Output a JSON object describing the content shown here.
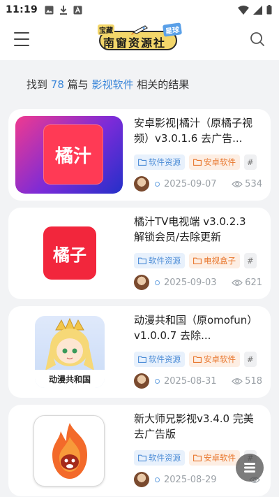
{
  "status_bar": {
    "time": "11:19"
  },
  "header": {
    "logo_main": "南窗资源社",
    "logo_tag_left": "宝藏",
    "logo_tag_right": "星球"
  },
  "search_result": {
    "prefix": "找到",
    "count": "78",
    "middle": "篇与",
    "keyword": "影视软件",
    "suffix": "相关的结果"
  },
  "posts": [
    {
      "title": "安卓影视|橘汁（原橘子视频）v3.0.1.6 去广告...",
      "thumb_text": "橘汁",
      "tags": [
        {
          "label": "软件资源",
          "style": "blue"
        },
        {
          "label": "安卓软件",
          "style": "orange"
        },
        {
          "label": "#",
          "style": "hash"
        }
      ],
      "date": "2025-09-07",
      "views": "534"
    },
    {
      "title": "橘汁TV电视端 v3.0.2.3 解锁会员/去除更新",
      "thumb_text": "橘子",
      "tags": [
        {
          "label": "软件资源",
          "style": "blue"
        },
        {
          "label": "电视盒子",
          "style": "orange"
        },
        {
          "label": "#",
          "style": "hash"
        }
      ],
      "date": "2025-09-03",
      "views": "621"
    },
    {
      "title": "动漫共和国（原omofun）v1.0.0.7 去除...",
      "thumb_text": "动漫共和国",
      "tags": [
        {
          "label": "软件资源",
          "style": "blue"
        },
        {
          "label": "安卓软件",
          "style": "orange"
        },
        {
          "label": "#",
          "style": "hash"
        }
      ],
      "date": "2025-08-31",
      "views": "518"
    },
    {
      "title": "新大师兄影视v3.4.0 完美去广告版",
      "thumb_text": "",
      "tags": [
        {
          "label": "软件资源",
          "style": "blue"
        },
        {
          "label": "安卓软件",
          "style": "orange"
        },
        {
          "label": "#",
          "style": "hash"
        }
      ],
      "date": "2025-08-29",
      "views": ""
    }
  ],
  "colors": {
    "accent": "#3a86d9",
    "tag_blue_bg": "#e8f1fc",
    "tag_orange_bg": "#fdeee3",
    "page_bg": "#f2f3f5"
  },
  "icons": {
    "menu": "hamburger-icon",
    "search": "search-icon",
    "folder": "folder-icon",
    "views": "eye-icon",
    "fab": "stack-icon"
  }
}
